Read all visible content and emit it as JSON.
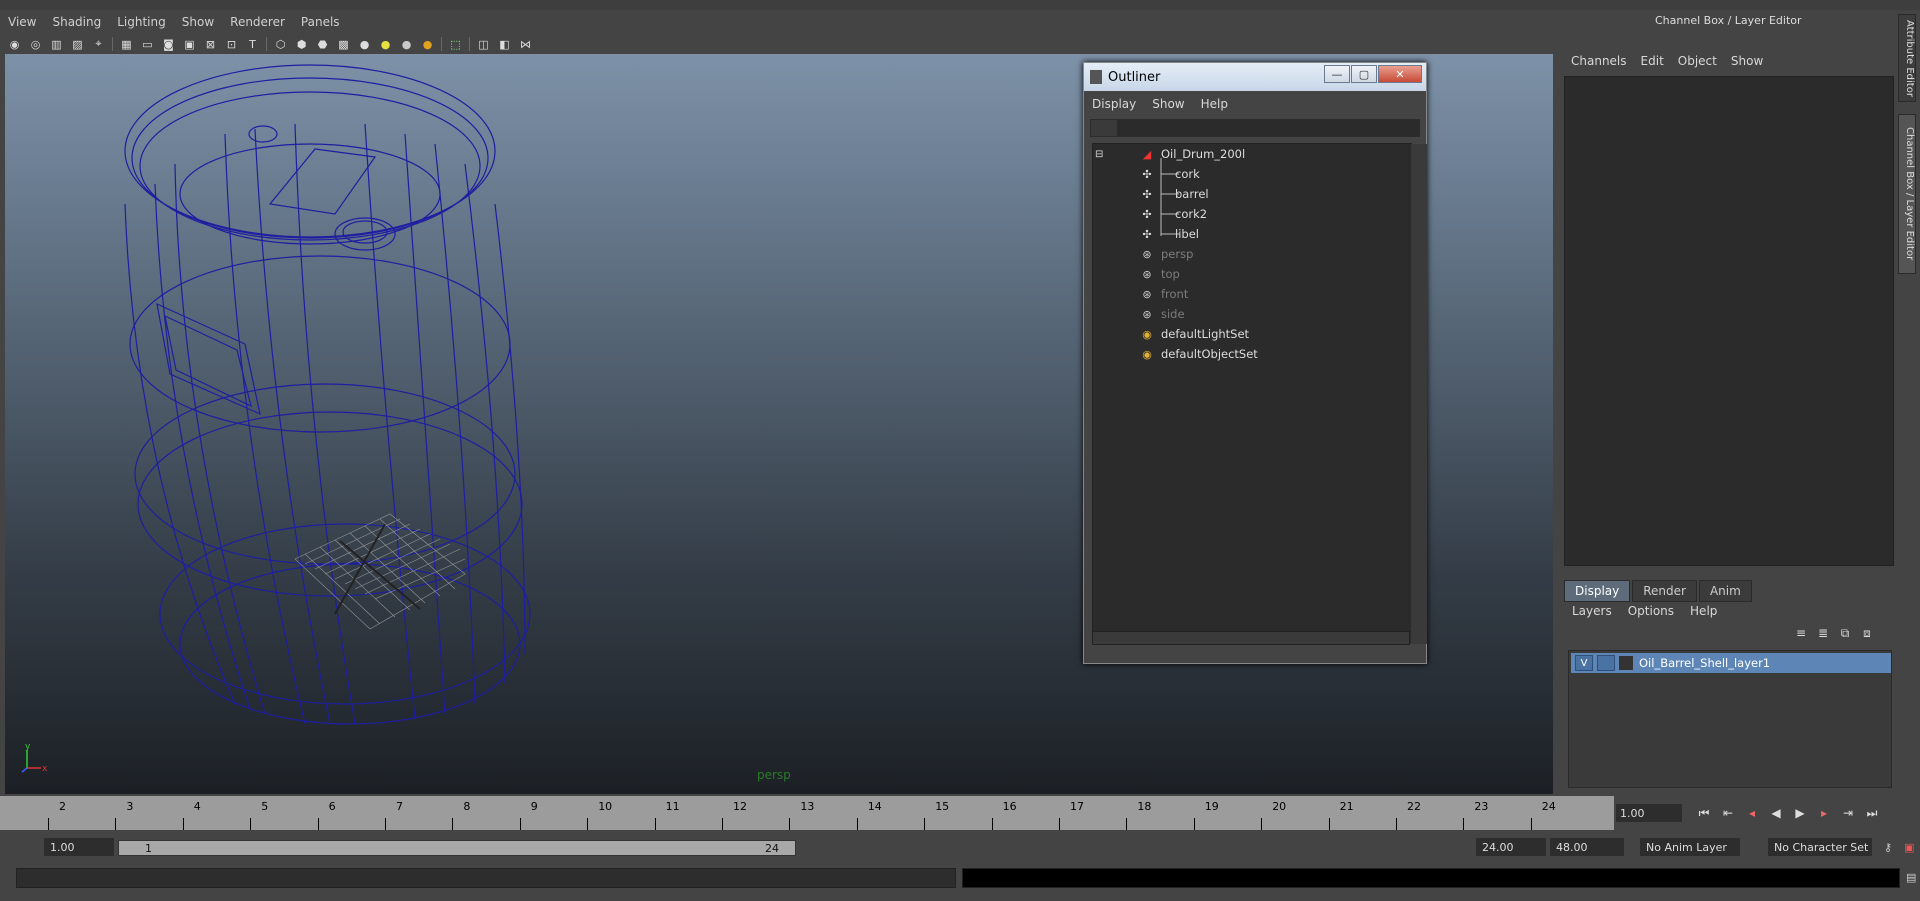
{
  "menu": {
    "items": [
      "View",
      "Shading",
      "Lighting",
      "Show",
      "Renderer",
      "Panels"
    ]
  },
  "viewport": {
    "camera_label": "persp"
  },
  "outliner": {
    "title": "Outliner",
    "menu": [
      "Display",
      "Show",
      "Help"
    ],
    "items": [
      {
        "label": "Oil_Drum_200l",
        "dim": false
      },
      {
        "label": "cork",
        "dim": false
      },
      {
        "label": "barrel",
        "dim": false
      },
      {
        "label": "cork2",
        "dim": false
      },
      {
        "label": "libel",
        "dim": false
      },
      {
        "label": "persp",
        "dim": true
      },
      {
        "label": "top",
        "dim": true
      },
      {
        "label": "front",
        "dim": true
      },
      {
        "label": "side",
        "dim": true
      },
      {
        "label": "defaultLightSet",
        "dim": false
      },
      {
        "label": "defaultObjectSet",
        "dim": false
      }
    ]
  },
  "channel_box": {
    "title": "Channel Box / Layer Editor",
    "menu": [
      "Channels",
      "Edit",
      "Object",
      "Show"
    ],
    "side_tabs": [
      "Attribute Editor",
      "Channel Box / Layer Editor"
    ]
  },
  "layer_editor": {
    "tabs": [
      "Display",
      "Render",
      "Anim"
    ],
    "menu": [
      "Layers",
      "Options",
      "Help"
    ],
    "layer": {
      "visible": "V",
      "name": "Oil_Barrel_Shell_layer1"
    }
  },
  "timeline": {
    "ticks": [
      "2",
      "3",
      "4",
      "5",
      "6",
      "7",
      "8",
      "9",
      "10",
      "11",
      "12",
      "13",
      "14",
      "15",
      "16",
      "17",
      "18",
      "19",
      "20",
      "21",
      "22",
      "23",
      "24"
    ],
    "current_frame": "1.00"
  },
  "range": {
    "start": "1.00",
    "slider_start": "1",
    "slider_end": "24",
    "end": "24.00",
    "anim_end": "48.00",
    "anim_layer": "No Anim Layer",
    "character_set": "No Character Set"
  }
}
